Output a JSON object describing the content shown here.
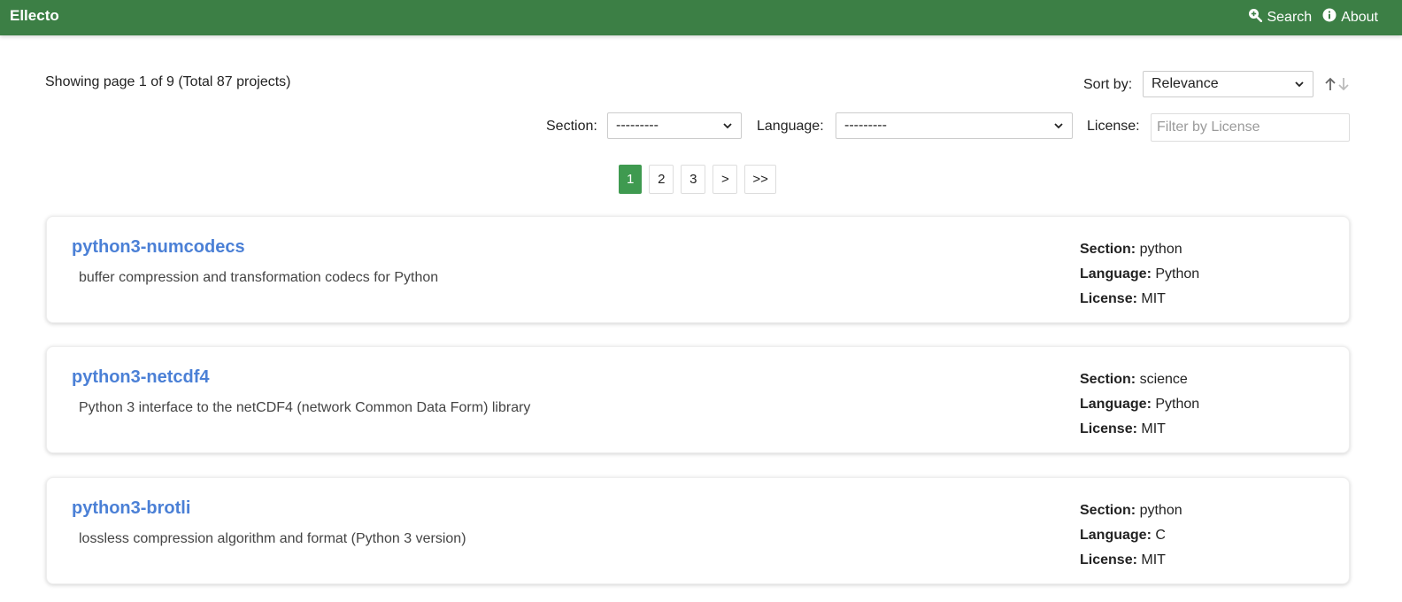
{
  "navbar": {
    "brand": "Ellecto",
    "links": [
      {
        "label": "Search",
        "icon": "search-plus-icon"
      },
      {
        "label": "About",
        "icon": "info-circle-icon"
      }
    ],
    "color": "#3c7f45"
  },
  "status_text": "Showing page 1 of 9 (Total 87 projects)",
  "sort": {
    "label": "Sort by:",
    "selected": "Relevance"
  },
  "filters": {
    "section_label": "Section:",
    "section_value": "---------",
    "language_label": "Language:",
    "language_value": "---------",
    "license_label": "License:",
    "license_placeholder": "Filter by License"
  },
  "pagination": {
    "pages": [
      "1",
      "2",
      "3"
    ],
    "next": ">",
    "last": ">>",
    "active": "1"
  },
  "meta_labels": {
    "section": "Section:",
    "language": "Language:",
    "license": "License:"
  },
  "projects": [
    {
      "name": "python3-numcodecs",
      "description": "buffer compression and transformation codecs for Python",
      "section": "python",
      "language": "Python",
      "license": "MIT"
    },
    {
      "name": "python3-netcdf4",
      "description": "Python 3 interface to the netCDF4 (network Common Data Form) library",
      "section": "science",
      "language": "Python",
      "license": "MIT"
    },
    {
      "name": "python3-brotli",
      "description": "lossless compression algorithm and format (Python 3 version)",
      "section": "python",
      "language": "C",
      "license": "MIT"
    }
  ]
}
